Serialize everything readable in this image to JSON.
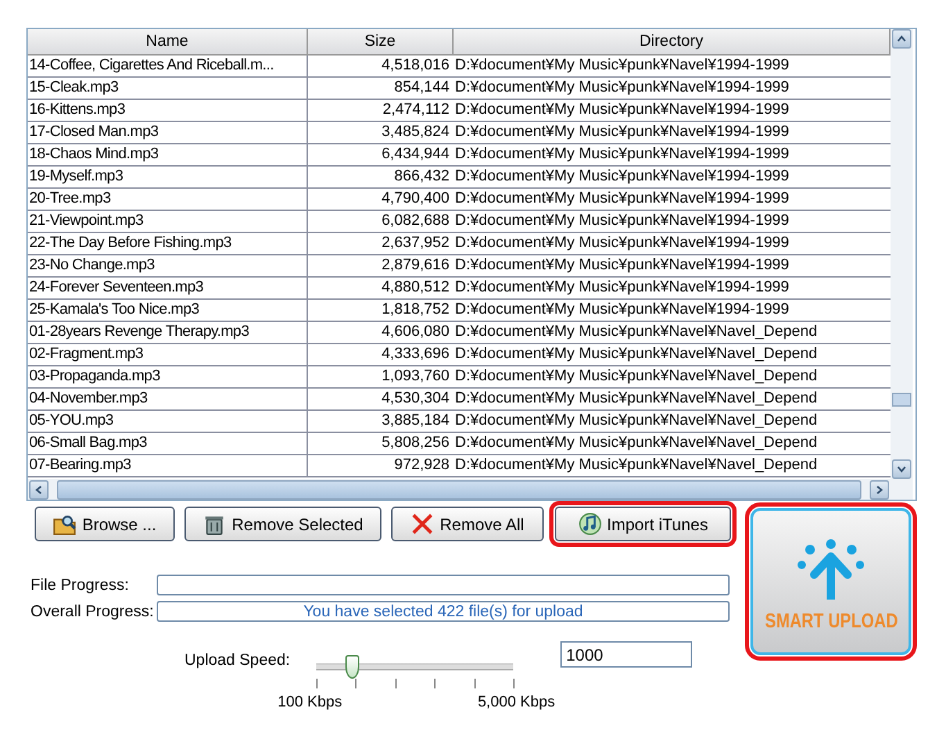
{
  "table": {
    "columns": [
      "Name",
      "Size",
      "Directory"
    ],
    "rows": [
      [
        "14-Coffee, Cigarettes And Riceball.m...",
        "4,518,016",
        "D:¥document¥My Music¥punk¥Navel¥1994-1999"
      ],
      [
        "15-Cleak.mp3",
        "854,144",
        "D:¥document¥My Music¥punk¥Navel¥1994-1999"
      ],
      [
        "16-Kittens.mp3",
        "2,474,112",
        "D:¥document¥My Music¥punk¥Navel¥1994-1999"
      ],
      [
        "17-Closed Man.mp3",
        "3,485,824",
        "D:¥document¥My Music¥punk¥Navel¥1994-1999"
      ],
      [
        "18-Chaos Mind.mp3",
        "6,434,944",
        "D:¥document¥My Music¥punk¥Navel¥1994-1999"
      ],
      [
        "19-Myself.mp3",
        "866,432",
        "D:¥document¥My Music¥punk¥Navel¥1994-1999"
      ],
      [
        "20-Tree.mp3",
        "4,790,400",
        "D:¥document¥My Music¥punk¥Navel¥1994-1999"
      ],
      [
        "21-Viewpoint.mp3",
        "6,082,688",
        "D:¥document¥My Music¥punk¥Navel¥1994-1999"
      ],
      [
        "22-The Day Before Fishing.mp3",
        "2,637,952",
        "D:¥document¥My Music¥punk¥Navel¥1994-1999"
      ],
      [
        "23-No Change.mp3",
        "2,879,616",
        "D:¥document¥My Music¥punk¥Navel¥1994-1999"
      ],
      [
        "24-Forever Seventeen.mp3",
        "4,880,512",
        "D:¥document¥My Music¥punk¥Navel¥1994-1999"
      ],
      [
        "25-Kamala's Too Nice.mp3",
        "1,818,752",
        "D:¥document¥My Music¥punk¥Navel¥1994-1999"
      ],
      [
        "01-28years Revenge Therapy.mp3",
        "4,606,080",
        "D:¥document¥My Music¥punk¥Navel¥Navel_Depend"
      ],
      [
        "02-Fragment.mp3",
        "4,333,696",
        "D:¥document¥My Music¥punk¥Navel¥Navel_Depend"
      ],
      [
        "03-Propaganda.mp3",
        "1,093,760",
        "D:¥document¥My Music¥punk¥Navel¥Navel_Depend"
      ],
      [
        "04-November.mp3",
        "4,530,304",
        "D:¥document¥My Music¥punk¥Navel¥Navel_Depend"
      ],
      [
        "05-YOU.mp3",
        "3,885,184",
        "D:¥document¥My Music¥punk¥Navel¥Navel_Depend"
      ],
      [
        "06-Small Bag.mp3",
        "5,808,256",
        "D:¥document¥My Music¥punk¥Navel¥Navel_Depend"
      ],
      [
        "07-Bearing.mp3",
        "972,928",
        "D:¥document¥My Music¥punk¥Navel¥Navel_Depend"
      ]
    ]
  },
  "buttons": [
    {
      "kind": "browse",
      "label": "Browse ...",
      "highlighted": false
    },
    {
      "kind": "remove-selected",
      "label": "Remove Selected",
      "highlighted": false
    },
    {
      "kind": "remove-all",
      "label": "Remove All",
      "highlighted": false
    },
    {
      "kind": "import",
      "label": "Import iTunes",
      "highlighted": true
    }
  ],
  "smart_upload": {
    "label": "SMART UPLOAD",
    "highlighted": true
  },
  "progress": [
    {
      "label": "File Progress:",
      "level": 0
    },
    {
      "label": "Overall Progress:",
      "level": 0,
      "message": "You have selected 422 file(s) for upload"
    }
  ],
  "upload_speed": {
    "label": "Upload Speed:",
    "level": 0.18,
    "min_label": "100 Kbps",
    "max_label": "5,000 Kbps",
    "value": "1000"
  }
}
